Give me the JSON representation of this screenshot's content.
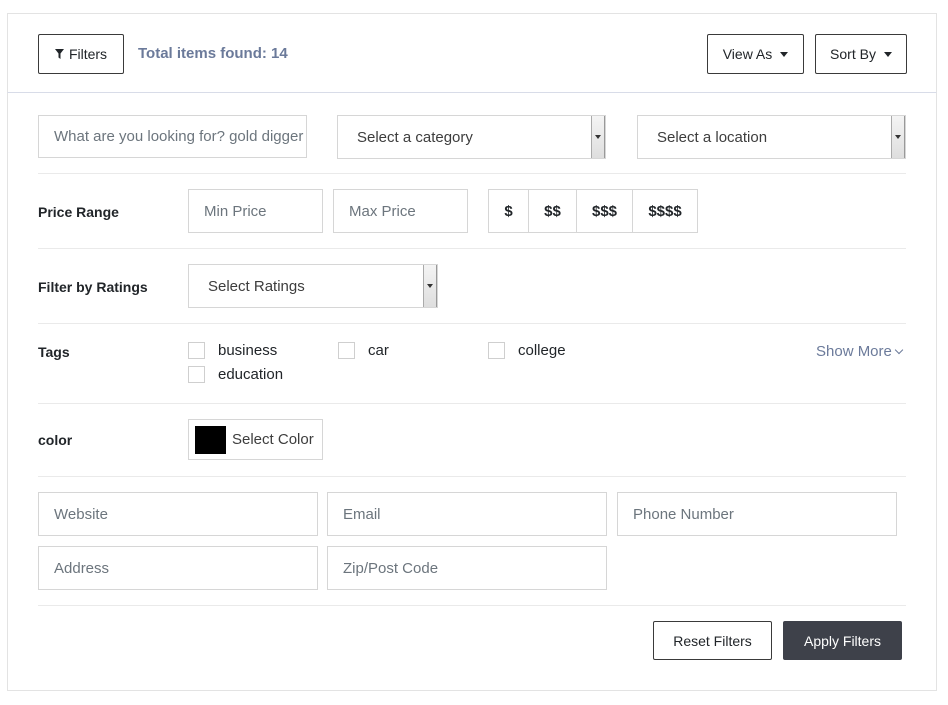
{
  "header": {
    "filters_label": "Filters",
    "total_text": "Total items found: 14",
    "view_as_label": "View As",
    "sort_by_label": "Sort By"
  },
  "search": {
    "keyword_placeholder": "What are you looking for? gold digger",
    "category_placeholder": "Select a category",
    "location_placeholder": "Select a location"
  },
  "price_range": {
    "label": "Price Range",
    "min_placeholder": "Min Price",
    "max_placeholder": "Max Price",
    "levels": [
      "$",
      "$$",
      "$$$",
      "$$$$"
    ]
  },
  "ratings": {
    "label": "Filter by Ratings",
    "placeholder": "Select Ratings"
  },
  "tags": {
    "label": "Tags",
    "items": [
      "business",
      "car",
      "college",
      "education"
    ],
    "show_more": "Show More"
  },
  "color": {
    "label": "color",
    "picker_label": "Select Color",
    "value": "#000000"
  },
  "contact_fields": {
    "website": "Website",
    "email": "Email",
    "phone": "Phone Number",
    "address": "Address",
    "zip": "Zip/Post Code"
  },
  "actions": {
    "reset_label": "Reset Filters",
    "apply_label": "Apply Filters"
  }
}
